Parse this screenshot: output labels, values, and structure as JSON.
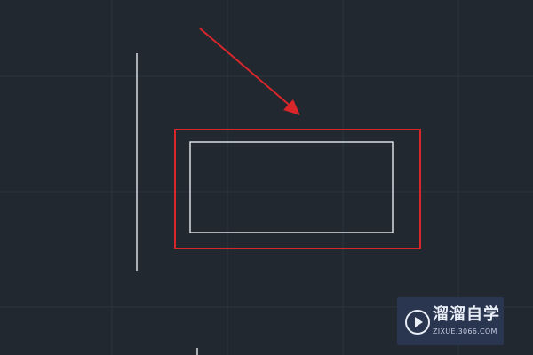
{
  "colors": {
    "background": "#212830",
    "grid_line": "#2c3440",
    "cad_line": "#d9dde3",
    "annotation_red": "#d8262b",
    "watermark_bg": "#2a3550"
  },
  "watermark": {
    "title": "溜溜自学",
    "subtitle": "ZIXUE.3066.COM",
    "icon": "play-icon"
  }
}
